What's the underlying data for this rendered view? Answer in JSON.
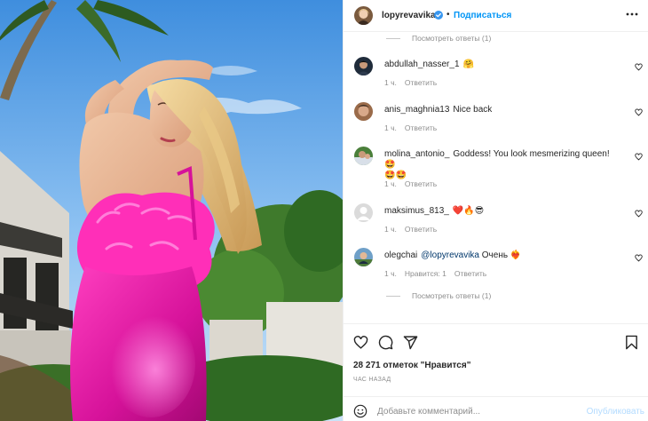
{
  "post": {
    "author": "lopyrevavika",
    "verified": true,
    "separator": "•",
    "follow_label": "Подписаться",
    "more_icon": "more-options-icon"
  },
  "comments": [
    {
      "type": "view_replies",
      "label": "Посмотреть ответы (1)"
    },
    {
      "username": "abdullah_nasser_1",
      "text": "🤗",
      "time": "1 ч.",
      "likes": "",
      "reply_label": "Ответить"
    },
    {
      "username": "anis_maghnia13",
      "text": "Nice back",
      "time": "1 ч.",
      "likes": "",
      "reply_label": "Ответить"
    },
    {
      "username": "molina_antonio_",
      "text": "Goddess! You look mesmerizing queen! 🤩",
      "text_line2": "🤩🤩",
      "time": "1 ч.",
      "likes": "",
      "reply_label": "Ответить"
    },
    {
      "username": "maksimus_813_",
      "text": "❤️🔥😎",
      "time": "1 ч.",
      "likes": "",
      "reply_label": "Ответить"
    },
    {
      "username": "olegchai",
      "mention": "@lopyrevavika",
      "text": "Очень ❤️‍🔥",
      "time": "1 ч.",
      "likes": "Нравится: 1",
      "reply_label": "Ответить"
    },
    {
      "type": "view_replies",
      "label": "Посмотреть ответы (1)"
    }
  ],
  "actions": {
    "like_icon": "heart-icon",
    "comment_icon": "comment-icon",
    "share_icon": "share-icon",
    "save_icon": "bookmark-icon"
  },
  "likes_text": "28 271 отметок \"Нравится\"",
  "time_ago": "Час назад",
  "compose": {
    "emoji_icon": "emoji-icon",
    "placeholder": "Добавьте комментарий...",
    "publish_label": "Опубликовать"
  },
  "colors": {
    "accent": "#0095f6",
    "verified": "#3897f0",
    "text": "#262626",
    "secondary": "#8e8e8e",
    "publish_disabled": "#b3dbff",
    "dress": "#e0159e"
  }
}
